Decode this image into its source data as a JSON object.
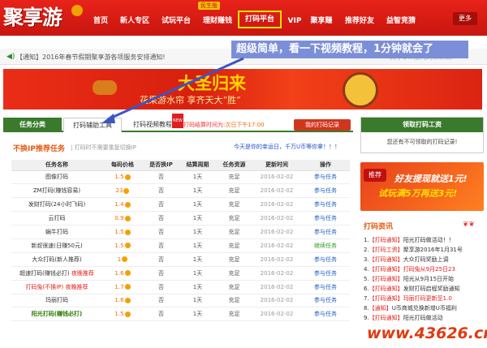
{
  "nav": {
    "logo": "聚享游",
    "items": [
      "首页",
      "新人专区",
      "试玩平台",
      "理财赚钱",
      "打码平台",
      "VIP",
      "聚享赚",
      "推荐好友",
      "益智竞猜"
    ],
    "badge": "民生版",
    "more": "更多"
  },
  "notice": {
    "icon": "speaker-icon",
    "text": "【通知】2016年春节假期聚享游各项服务安排通知!",
    "text_right": "关于1%福利的新系统"
  },
  "callout": "超级简单，看一下视频教程，1分钟就会了",
  "banner": {
    "headline": "大圣归来",
    "sub": "花果游水帘 享齐天大“胜”"
  },
  "tabs": [
    "任务分类",
    "打码辅助工具",
    "打码视频教程"
  ],
  "tab_new": "NEW",
  "tab_info_label": "打码结算时间为:",
  "tab_info_value": "次日下午17:00",
  "record_button": "我的打码记录",
  "section": {
    "title": "不换IP推荐任务",
    "hint": "| 打码时不需要重复切换IP",
    "right": "今天是你的幸运日，千万U币等你拿！！！"
  },
  "table": {
    "headers": [
      "任务名称",
      "每码价格",
      "是否换IP",
      "结算周期",
      "任务资源",
      "更新时间",
      "操作"
    ],
    "rows": [
      {
        "name": "图像打码",
        "tag": "",
        "price": "1.5",
        "ip": "否",
        "cycle": "1天",
        "res": "充足",
        "date": "2016-02-02",
        "op": "参与任务"
      },
      {
        "name": "ZM打码(赚钱容易)",
        "tag": "",
        "price": "23",
        "ip": "否",
        "cycle": "1天",
        "res": "充足",
        "date": "2016-02-02",
        "op": "参与任务"
      },
      {
        "name": "发财打码(24小时飞码)",
        "tag": "",
        "price": "1.4",
        "ip": "否",
        "cycle": "1天",
        "res": "充足",
        "date": "2016-02-02",
        "op": "参与任务"
      },
      {
        "name": "云打码",
        "tag": "",
        "price": "0.9",
        "ip": "否",
        "cycle": "1天",
        "res": "充足",
        "date": "2016-02-02",
        "op": "参与任务"
      },
      {
        "name": "蜗牛打码",
        "tag": "",
        "price": "1.5",
        "ip": "否",
        "cycle": "1天",
        "res": "充足",
        "date": "2016-02-02",
        "op": "参与任务"
      },
      {
        "name": "新叔很速(日赚50元)",
        "tag": "",
        "price": "1.5",
        "ip": "否",
        "cycle": "1天",
        "res": "充足",
        "date": "2016-02-02",
        "op": "继续任务"
      },
      {
        "name": "大众打码(新人推荐)",
        "tag": "",
        "price": "1",
        "ip": "否",
        "cycle": "1天",
        "res": "充足",
        "date": "2016-02-02",
        "op": "参与任务"
      },
      {
        "name": "超速打码(赚钱必打)",
        "tag": "夜晚推荐",
        "price": "1.6",
        "ip": "否",
        "cycle": "1天",
        "res": "充足",
        "date": "2016-02-02",
        "op": "参与任务"
      },
      {
        "name": "打码兔(不换IP)",
        "tag": "夜晚推荐",
        "price": "1.7",
        "ip": "否",
        "cycle": "1天",
        "res": "充足",
        "date": "2016-02-02",
        "op": "参与任务"
      },
      {
        "name": "玛丽打码",
        "tag": "",
        "price": "1.6",
        "ip": "否",
        "cycle": "1天",
        "res": "充足",
        "date": "2016-02-02",
        "op": "参与任务"
      },
      {
        "name": "阳光打码(赚钱必打)",
        "tag": "",
        "price": "1.5",
        "ip": "否",
        "cycle": "1天",
        "res": "充足",
        "date": "2016-02-02",
        "op": "参与任务"
      }
    ]
  },
  "side_panel": {
    "title": "领取打码工资",
    "body": "您还有不可领取的打码记录!"
  },
  "ad": {
    "tag": "推荐",
    "line1": "好友提现就送1元!",
    "line2": "试玩满5万再送3元!"
  },
  "news": {
    "title": "打码资讯",
    "items": [
      {
        "no": "1.",
        "tag": "【打码通知】",
        "text": "阳光打码做活动！！"
      },
      {
        "no": "2.",
        "tag": "【打码工资】",
        "text": "聚享游2016年1月31号"
      },
      {
        "no": "3.",
        "tag": "【打码通知】",
        "text": "大众打码奖励上调"
      },
      {
        "no": "4.",
        "tag": "【打码通知】",
        "text": "打码兔从9月25日23"
      },
      {
        "no": "5.",
        "tag": "【打码通知】",
        "text": "阳光从9月15日开始"
      },
      {
        "no": "6.",
        "tag": "【打码通知】",
        "text": "发财打码启程奖励通知"
      },
      {
        "no": "7.",
        "tag": "【打码通知】",
        "text": "玛丽打码更新至1.0"
      },
      {
        "no": "8.",
        "tag": "【通知】",
        "text": "U币商城兑换新增U币福利"
      },
      {
        "no": "9.",
        "tag": "【打码通知】",
        "text": "阳光打码做活动"
      }
    ]
  },
  "watermark": "www.43626.cn",
  "colors": {
    "nav_red": "#d01b12",
    "green": "#3a7a2c",
    "callout": "#7b8fd8",
    "accent_orange": "#e55a10"
  }
}
